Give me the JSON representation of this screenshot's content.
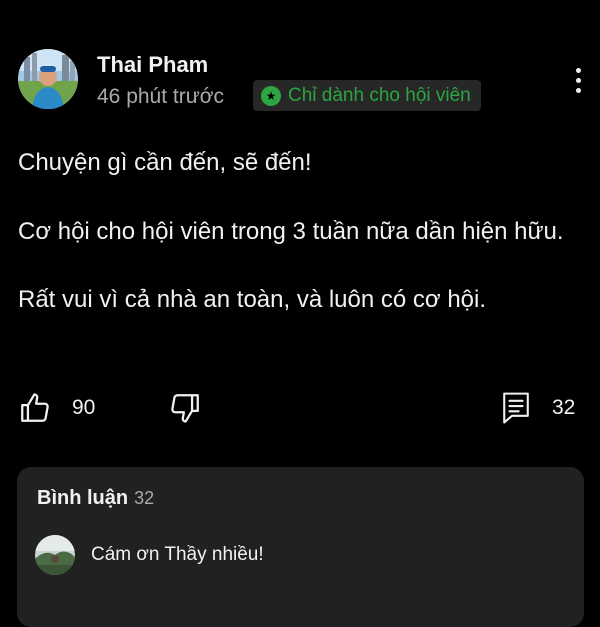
{
  "post": {
    "author": "Thai Pham",
    "time": "46 phút trước",
    "badge_label": "Chỉ dành cho hội viên",
    "badge_icon": "star-icon",
    "menu_icon": "more-vertical-icon",
    "paragraphs": [
      "Chuyện gì cần đến, sẽ đến!",
      "Cơ hội cho hội viên trong 3 tuần nữa dần hiện hữu.",
      "Rất vui vì cả nhà an toàn, và luôn có cơ hội."
    ]
  },
  "actions": {
    "like_icon": "thumbs-up-icon",
    "like_count": "90",
    "dislike_icon": "thumbs-down-icon",
    "comment_icon": "comment-icon",
    "comment_count": "32"
  },
  "comments": {
    "title": "Bình luận",
    "count": "32",
    "first_comment": {
      "text": "Cám ơn Thầy nhiều!"
    }
  },
  "colors": {
    "background": "#000000",
    "panel": "#212121",
    "badge_bg": "#272727",
    "accent_green": "#2ba640",
    "text": "#f1f1f1",
    "secondary_text": "#aaaaaa"
  }
}
